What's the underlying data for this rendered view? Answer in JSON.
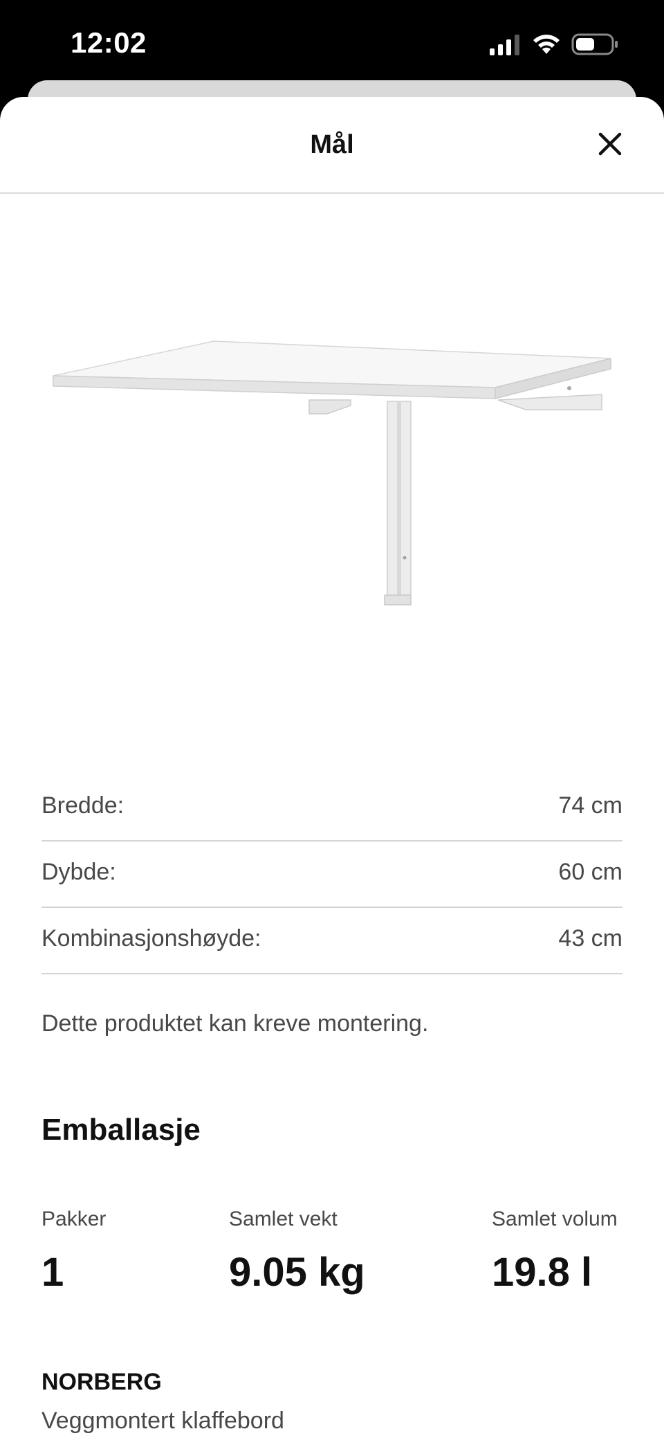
{
  "status_bar": {
    "time": "12:02",
    "icons": [
      "cellular-signal-icon",
      "wifi-icon",
      "battery-icon"
    ]
  },
  "header": {
    "title": "Mål",
    "close_icon": "close-icon"
  },
  "product_image": {
    "alt": "white wall-mounted drop-leaf table"
  },
  "dimensions": [
    {
      "label": "Bredde:",
      "value": "74 cm"
    },
    {
      "label": "Dybde:",
      "value": "60 cm"
    },
    {
      "label": "Kombinasjonshøyde:",
      "value": "43 cm"
    }
  ],
  "assembly_note": "Dette produktet kan kreve montering.",
  "packaging": {
    "title": "Emballasje",
    "packages_label": "Pakker",
    "packages_value": "1",
    "weight_label": "Samlet vekt",
    "weight_value": "9.05 kg",
    "volume_label": "Samlet volum",
    "volume_value": "19.8 l"
  },
  "product": {
    "name": "NORBERG",
    "description": "Veggmontert klaffebord"
  }
}
